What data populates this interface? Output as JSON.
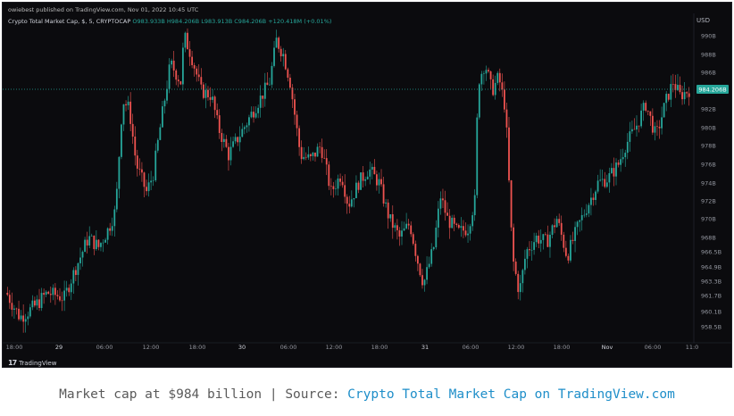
{
  "header": {
    "publisher": "owiebest published on TradingView.com, Nov 01, 2022 10:45 UTC",
    "symbol": "Crypto Total Market Cap, $, 5, CRYPTOCAP",
    "ohlc": {
      "o": "O983.933B",
      "h": "H984.206B",
      "l": "L983.913B",
      "c": "C984.206B",
      "change": "+120.418M (+0.01%)"
    },
    "currency": "USD"
  },
  "footer": {
    "logo_text": "TradingView",
    "logo_mark": "17"
  },
  "caption": {
    "prefix": "Market cap at $984 billion | Source: ",
    "link_text": "Crypto Total Market Cap on TradingView.com"
  },
  "colors": {
    "up": "#26a69a",
    "down": "#ef5350",
    "background": "#0b0b0e",
    "last_price_tag": "#26a69a"
  },
  "chart_data": {
    "type": "candlestick",
    "title": "Crypto Total Market Cap, $, 5, CRYPTOCAP",
    "interval": "5",
    "unit": "USD",
    "y_ticks": [
      "990B",
      "988B",
      "986B",
      "984.206B",
      "982B",
      "980B",
      "978B",
      "976B",
      "974B",
      "972B",
      "970B",
      "968B",
      "966.5B",
      "964.9B",
      "963.3B",
      "961.7B",
      "960.1B",
      "958.5B"
    ],
    "y_tick_values": [
      990,
      988,
      986,
      984.206,
      982,
      980,
      978,
      976,
      974,
      972,
      970,
      968,
      966.5,
      964.9,
      963.3,
      961.7,
      960.1,
      958.5
    ],
    "x_ticks": [
      "18:00",
      "29",
      "06:00",
      "12:00",
      "18:00",
      "30",
      "06:00",
      "12:00",
      "18:00",
      "31",
      "06:00",
      "12:00",
      "18:00",
      "Nov",
      "06:00",
      "11:0"
    ],
    "last_price": 984.206,
    "last_price_label": "984.206B",
    "approx_path": [
      [
        0,
        962.0
      ],
      [
        0.02,
        959.5
      ],
      [
        0.04,
        960.5
      ],
      [
        0.06,
        962.0
      ],
      [
        0.085,
        961.5
      ],
      [
        0.1,
        964.5
      ],
      [
        0.12,
        968.0
      ],
      [
        0.135,
        967.0
      ],
      [
        0.15,
        969.0
      ],
      [
        0.16,
        971.0
      ],
      [
        0.17,
        983.0
      ],
      [
        0.18,
        982.0
      ],
      [
        0.19,
        976.0
      ],
      [
        0.205,
        973.0
      ],
      [
        0.215,
        975.0
      ],
      [
        0.225,
        980.0
      ],
      [
        0.24,
        987.0
      ],
      [
        0.255,
        985.0
      ],
      [
        0.26,
        990.0
      ],
      [
        0.27,
        988.0
      ],
      [
        0.285,
        984.0
      ],
      [
        0.3,
        983.5
      ],
      [
        0.31,
        980.0
      ],
      [
        0.325,
        977.0
      ],
      [
        0.34,
        979.0
      ],
      [
        0.355,
        981.0
      ],
      [
        0.37,
        983.0
      ],
      [
        0.385,
        985.0
      ],
      [
        0.395,
        989.5
      ],
      [
        0.405,
        988.0
      ],
      [
        0.415,
        985.0
      ],
      [
        0.43,
        977.0
      ],
      [
        0.445,
        976.5
      ],
      [
        0.46,
        978.0
      ],
      [
        0.475,
        973.0
      ],
      [
        0.49,
        975.0
      ],
      [
        0.5,
        971.5
      ],
      [
        0.515,
        974.0
      ],
      [
        0.53,
        975.5
      ],
      [
        0.545,
        974.0
      ],
      [
        0.56,
        970.0
      ],
      [
        0.575,
        968.0
      ],
      [
        0.59,
        969.5
      ],
      [
        0.6,
        966.0
      ],
      [
        0.61,
        963.0
      ],
      [
        0.625,
        967.0
      ],
      [
        0.635,
        972.5
      ],
      [
        0.645,
        970.0
      ],
      [
        0.66,
        968.5
      ],
      [
        0.675,
        969.0
      ],
      [
        0.685,
        972.0
      ],
      [
        0.69,
        985.0
      ],
      [
        0.7,
        987.0
      ],
      [
        0.71,
        984.0
      ],
      [
        0.72,
        985.5
      ],
      [
        0.73,
        982.0
      ],
      [
        0.74,
        966.0
      ],
      [
        0.75,
        962.0
      ],
      [
        0.76,
        966.5
      ],
      [
        0.775,
        968.0
      ],
      [
        0.79,
        967.5
      ],
      [
        0.805,
        970.0
      ],
      [
        0.82,
        966.0
      ],
      [
        0.835,
        969.0
      ],
      [
        0.85,
        971.5
      ],
      [
        0.865,
        974.0
      ],
      [
        0.88,
        974.5
      ],
      [
        0.895,
        976.0
      ],
      [
        0.905,
        978.0
      ],
      [
        0.92,
        980.0
      ],
      [
        0.935,
        982.5
      ],
      [
        0.95,
        979.0
      ],
      [
        0.965,
        983.0
      ],
      [
        0.975,
        985.0
      ],
      [
        0.985,
        983.5
      ],
      [
        1.0,
        984.2
      ]
    ]
  }
}
